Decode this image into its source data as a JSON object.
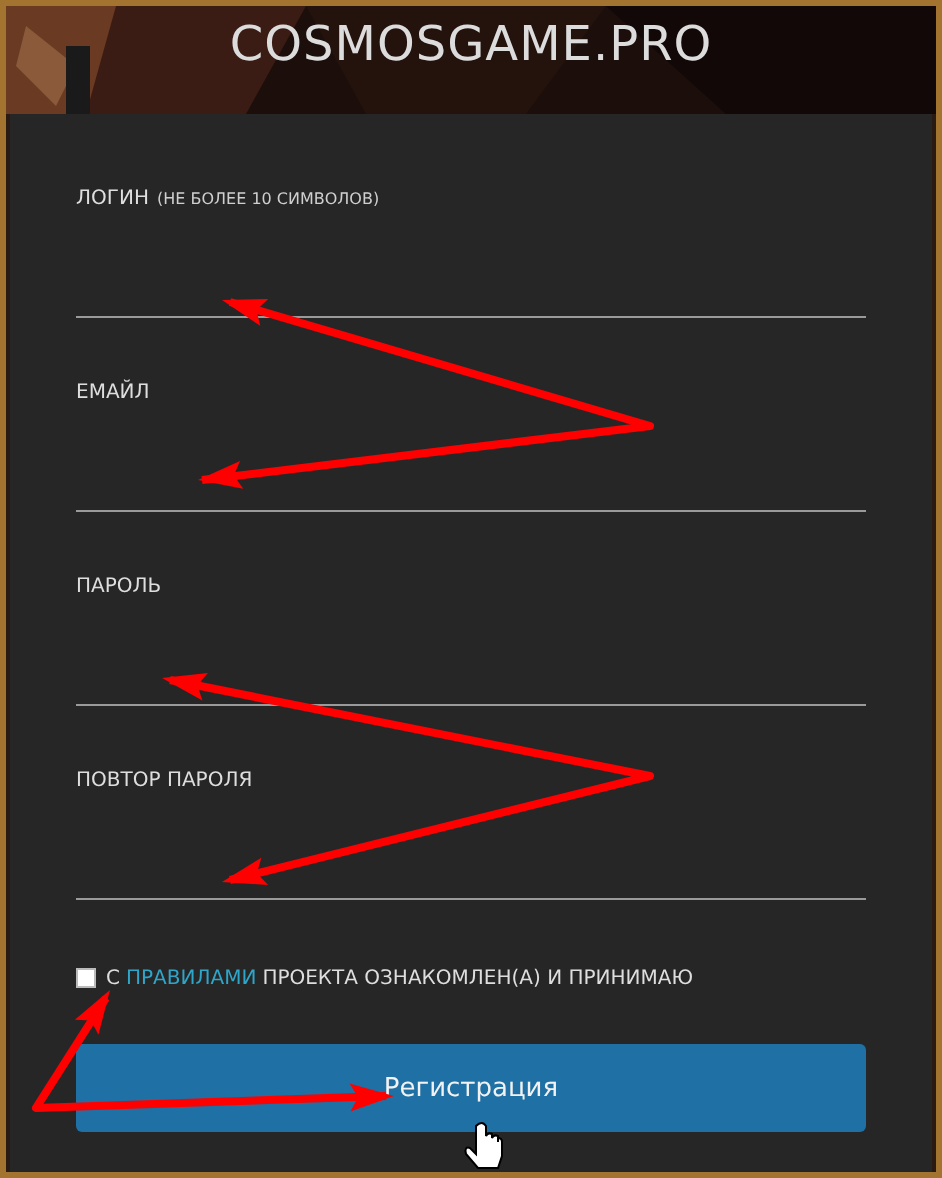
{
  "site_title": "COSMOSGAME.PRO",
  "fields": [
    {
      "label": "ЛОГИН",
      "hint": "(НЕ БОЛЕЕ 10 СИМВОЛОВ)"
    },
    {
      "label": "ЕМАЙЛ"
    },
    {
      "label": "ПАРОЛЬ"
    },
    {
      "label": "ПОВТОР ПАРОЛЯ"
    }
  ],
  "agreement": {
    "checked": false,
    "text_before": "С",
    "link": "ПРАВИЛАМИ",
    "text_after": "ПРОЕКТА ОЗНАКОМЛЕН(А) И ПРИНИМАЮ"
  },
  "submit_button": "Регистрация"
}
